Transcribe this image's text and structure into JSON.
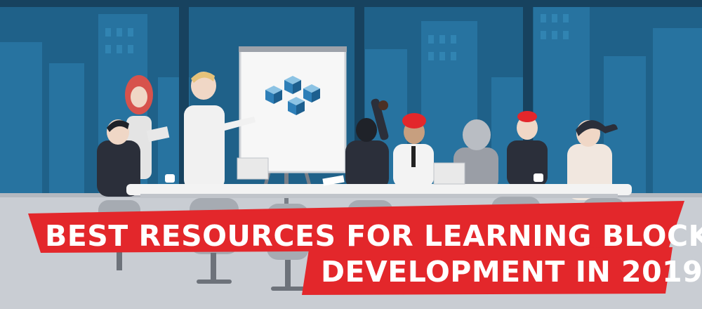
{
  "banner": {
    "line1": "BEST RESOURCES FOR LEARNING BLOCKCHAIN",
    "line2": "DEVELOPMENT IN 2019"
  },
  "colors": {
    "sky": "#1d5f86",
    "window_frame": "#184a6a",
    "floor": "#c7cbd0",
    "banner_red": "#e3272b",
    "table_top": "#f3f3f3",
    "figure_dark": "#2b2f3a",
    "figure_gray": "#9a9ea6",
    "skin": "#f0d7c6"
  },
  "icons": {
    "flipchart_graphic": "blockchain-cubes-icon"
  }
}
